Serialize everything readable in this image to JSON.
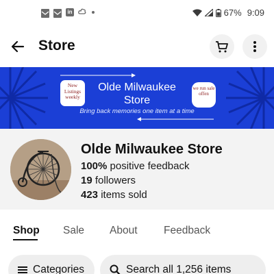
{
  "status_bar": {
    "battery": "67%",
    "time": "9:09",
    "icons": [
      "mail-icon",
      "mail-icon",
      "linkedin-icon",
      "cloud-icon",
      "dot-icon",
      "wifi-icon",
      "signal-icon",
      "battery-icon"
    ]
  },
  "header": {
    "title": "Store",
    "icons": [
      "back-arrow-icon",
      "cart-icon",
      "more-vert-icon"
    ]
  },
  "banner": {
    "title": "Olde Milwaukee Store",
    "tagline": "Bring back memories one item at a time",
    "badge_left": "New Listings weekly",
    "badge_right": "we run sale offen",
    "background_color": "#1b3fd6"
  },
  "store": {
    "name": "Olde Milwaukee Store",
    "feedback_value": "100%",
    "feedback_label": " positive feedback",
    "followers_value": "19",
    "followers_label": " followers",
    "sold_value": "423",
    "sold_label": " items sold"
  },
  "tabs": [
    {
      "label": "Shop",
      "active": true
    },
    {
      "label": "Sale",
      "active": false
    },
    {
      "label": "About",
      "active": false
    },
    {
      "label": "Feedback",
      "active": false
    }
  ],
  "controls": {
    "categories_label": "Categories",
    "search_label": "Search all 1,256 items"
  }
}
